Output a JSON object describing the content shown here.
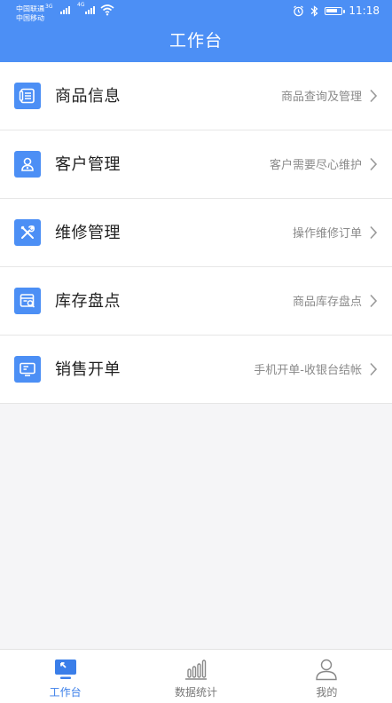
{
  "status": {
    "carrier1": "中国联通",
    "carrier1_net": "3G",
    "carrier2": "中国移动",
    "carrier2_net": "4G",
    "time": "11:18"
  },
  "header": {
    "title": "工作台"
  },
  "menu": [
    {
      "label": "商品信息",
      "desc": "商品查询及管理",
      "icon": "document-list-icon"
    },
    {
      "label": "客户管理",
      "desc": "客户需要尽心维护",
      "icon": "customer-icon"
    },
    {
      "label": "维修管理",
      "desc": "操作维修订单",
      "icon": "tools-icon"
    },
    {
      "label": "库存盘点",
      "desc": "商品库存盘点",
      "icon": "inventory-search-icon"
    },
    {
      "label": "销售开单",
      "desc": "手机开单-收银台结帐",
      "icon": "monitor-icon"
    }
  ],
  "tabs": [
    {
      "label": "工作台",
      "active": true,
      "icon": "workbench-icon"
    },
    {
      "label": "数据统计",
      "active": false,
      "icon": "bar-chart-icon"
    },
    {
      "label": "我的",
      "active": false,
      "icon": "user-icon"
    }
  ],
  "colors": {
    "header": "#4c8ff5",
    "icon_bg": "#4c8ff5",
    "active_tab": "#3a7ee9",
    "inactive_tab": "#777777"
  }
}
